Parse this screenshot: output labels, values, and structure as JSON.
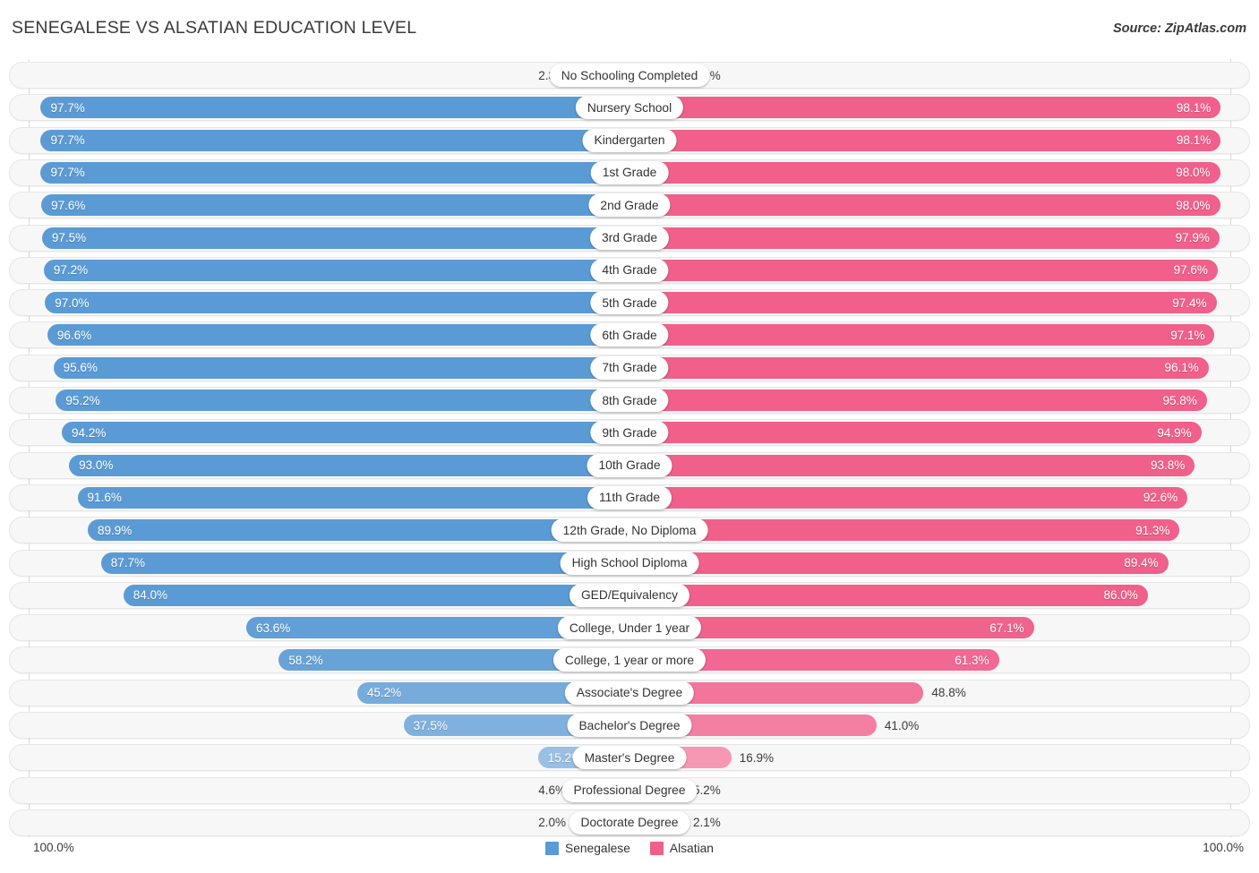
{
  "header": {
    "title": "Senegalese vs Alsatian Education Level",
    "source": "Source: ZipAtlas.com"
  },
  "footer": {
    "left_axis_max": "100.0%",
    "right_axis_max": "100.0%",
    "legend": [
      {
        "label": "Senegalese",
        "color": "#5b9bd5"
      },
      {
        "label": "Alsatian",
        "color": "#f0608b"
      }
    ]
  },
  "chart_data": {
    "type": "bar",
    "subtype": "diverging-paired-bar",
    "title": "Senegalese vs Alsatian Education Level",
    "xlabel": "",
    "ylabel": "",
    "xlim": [
      0,
      100
    ],
    "grid": false,
    "legend_position": "bottom-center",
    "units": "percent",
    "categories": [
      "No Schooling Completed",
      "Nursery School",
      "Kindergarten",
      "1st Grade",
      "2nd Grade",
      "3rd Grade",
      "4th Grade",
      "5th Grade",
      "6th Grade",
      "7th Grade",
      "8th Grade",
      "9th Grade",
      "10th Grade",
      "11th Grade",
      "12th Grade, No Diploma",
      "High School Diploma",
      "GED/Equivalency",
      "College, Under 1 year",
      "College, 1 year or more",
      "Associate's Degree",
      "Bachelor's Degree",
      "Master's Degree",
      "Professional Degree",
      "Doctorate Degree"
    ],
    "series": [
      {
        "name": "Senegalese",
        "color": "#5b9bd5",
        "values": [
          2.3,
          97.7,
          97.7,
          97.7,
          97.6,
          97.5,
          97.2,
          97.0,
          96.6,
          95.6,
          95.2,
          94.2,
          93.0,
          91.6,
          89.9,
          87.7,
          84.0,
          63.6,
          58.2,
          45.2,
          37.5,
          15.2,
          4.6,
          2.0
        ],
        "labels": [
          "2.3%",
          "97.7%",
          "97.7%",
          "97.7%",
          "97.6%",
          "97.5%",
          "97.2%",
          "97.0%",
          "96.6%",
          "95.6%",
          "95.2%",
          "94.2%",
          "93.0%",
          "91.6%",
          "89.9%",
          "87.7%",
          "84.0%",
          "63.6%",
          "58.2%",
          "45.2%",
          "37.5%",
          "15.2%",
          "4.6%",
          "2.0%"
        ]
      },
      {
        "name": "Alsatian",
        "color": "#f0608b",
        "values": [
          2.0,
          98.1,
          98.1,
          98.0,
          98.0,
          97.9,
          97.6,
          97.4,
          97.1,
          96.1,
          95.8,
          94.9,
          93.8,
          92.6,
          91.3,
          89.4,
          86.0,
          67.1,
          61.3,
          48.8,
          41.0,
          16.9,
          5.2,
          2.1
        ],
        "labels": [
          "2.0%",
          "98.1%",
          "98.1%",
          "98.0%",
          "98.0%",
          "97.9%",
          "97.6%",
          "97.4%",
          "97.1%",
          "96.1%",
          "95.8%",
          "94.9%",
          "93.8%",
          "92.6%",
          "91.3%",
          "89.4%",
          "86.0%",
          "67.1%",
          "61.3%",
          "48.8%",
          "41.0%",
          "16.9%",
          "5.2%",
          "2.1%"
        ]
      }
    ]
  }
}
